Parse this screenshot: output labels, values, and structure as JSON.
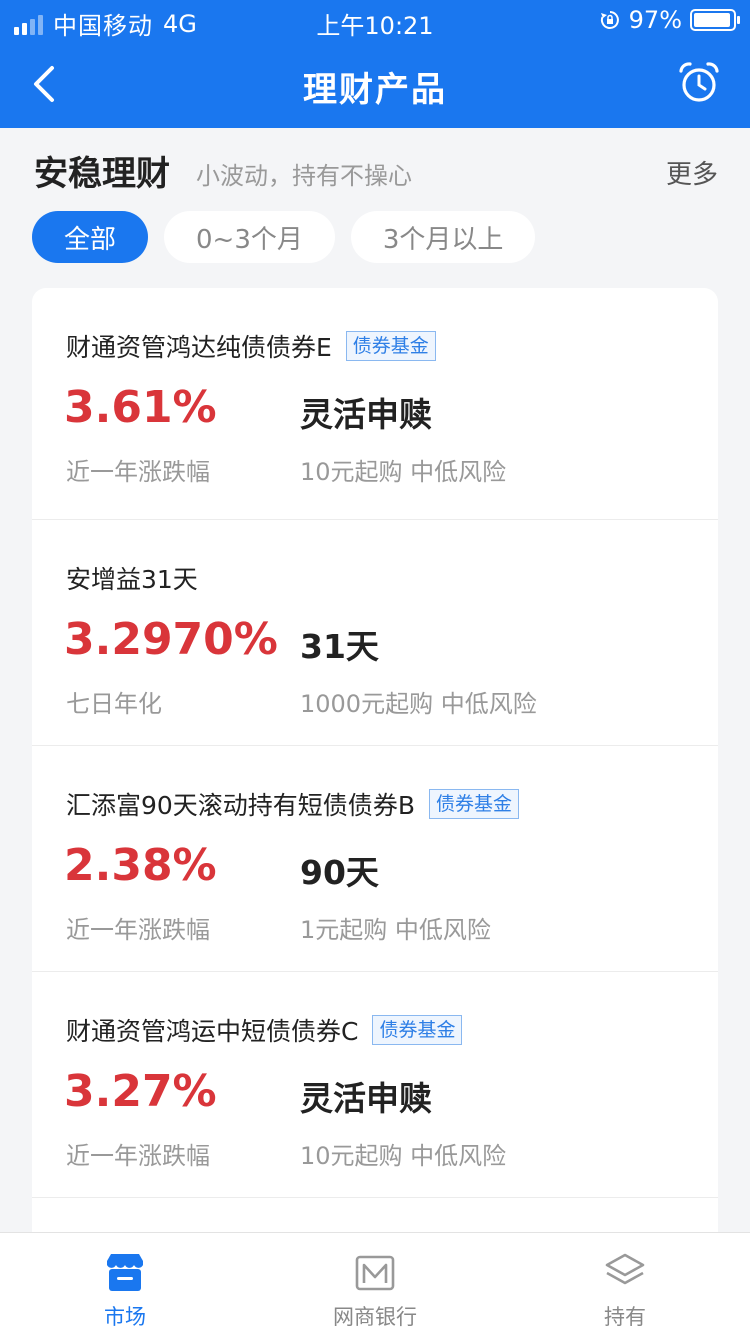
{
  "status_bar": {
    "carrier": "中国移动",
    "network": "4G",
    "time": "上午10:21",
    "battery": "97%"
  },
  "nav": {
    "title": "理财产品"
  },
  "section": {
    "title": "安稳理财",
    "subtitle": "小波动，持有不操心",
    "more": "更多"
  },
  "filters": [
    {
      "label": "全部",
      "active": true
    },
    {
      "label": "0~3个月",
      "active": false
    },
    {
      "label": "3个月以上",
      "active": false
    }
  ],
  "products": [
    {
      "name": "财通资管鸿达纯债债券E",
      "tag": "债券基金",
      "rate": "3.61%",
      "rate_label": "近一年涨跌幅",
      "term": "灵活申赎",
      "term_label": "10元起购 中低风险"
    },
    {
      "name": "安增益31天",
      "tag": "",
      "rate": "3.2970%",
      "rate_label": "七日年化",
      "term": "31天",
      "term_label": "1000元起购 中低风险"
    },
    {
      "name": "汇添富90天滚动持有短债债券B",
      "tag": "债券基金",
      "rate": "2.38%",
      "rate_label": "近一年涨跌幅",
      "term": "90天",
      "term_label": "1元起购 中低风险"
    },
    {
      "name": "财通资管鸿运中短债债券C",
      "tag": "债券基金",
      "rate": "3.27%",
      "rate_label": "近一年涨跌幅",
      "term": "灵活申赎",
      "term_label": "10元起购 中低风险"
    }
  ],
  "tabbar": [
    {
      "label": "市场",
      "icon": "store-icon",
      "active": true
    },
    {
      "label": "网商银行",
      "icon": "mybank-icon",
      "active": false
    },
    {
      "label": "持有",
      "icon": "layers-icon",
      "active": false
    }
  ],
  "colors": {
    "brand": "#1a77ef",
    "rate": "#d9353a",
    "tag": "#2e7fe6"
  }
}
